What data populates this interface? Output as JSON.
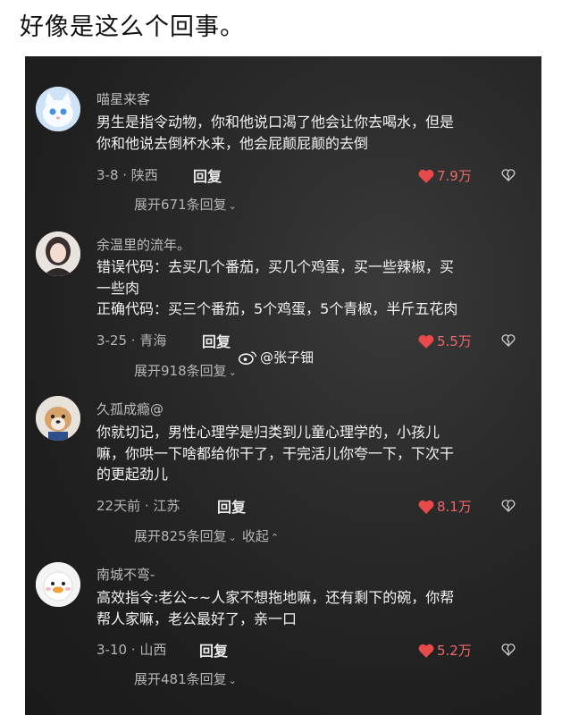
{
  "post": {
    "title": "好像是这么个回事。"
  },
  "watermark": {
    "text": "@张子钿"
  },
  "comments": [
    {
      "username": "喵星来客",
      "lines": [
        "男生是指令动物，你和他说口渴了他会让你去喝水，但是",
        "你和他说去倒杯水来，他会屁颠屁颠的去倒"
      ],
      "meta": "3-8 · 陕西",
      "reply": "回复",
      "likes": "7.9万",
      "expand": "展开671条回复",
      "avatar": "cat-avatar"
    },
    {
      "username": "余温里的流年。",
      "lines": [
        "错误代码：去买几个番茄，买几个鸡蛋，买一些辣椒，买",
        "一些肉",
        "正确代码：买三个番茄，5个鸡蛋，5个青椒，半斤五花肉"
      ],
      "meta": "3-25 · 青海",
      "reply": "回复",
      "likes": "5.5万",
      "expand": "展开918条回复",
      "avatar": "girl-avatar"
    },
    {
      "username": "久孤成瘾@",
      "lines": [
        "你就切记，男性心理学是归类到儿童心理学的，小孩儿",
        "嘛，你哄一下啥都给你干了，干完活儿你夸一下，下次干",
        "的更起劲儿"
      ],
      "meta": "22天前 · 江苏",
      "reply": "回复",
      "likes": "8.1万",
      "expand": "展开825条回复",
      "collapse": "收起",
      "avatar": "dog-avatar"
    },
    {
      "username": "南城不弯-",
      "lines": [
        "高效指令:老公~~人家不想拖地嘛，还有剩下的碗，你帮",
        "帮人家嘛，老公最好了，亲一口"
      ],
      "meta": "3-10 · 山西",
      "reply": "回复",
      "likes": "5.2万",
      "expand": "展开481条回复",
      "avatar": "duck-avatar"
    }
  ],
  "colors": {
    "like": "#e84a4a",
    "background": "#262626",
    "text": "#f2f2f2"
  }
}
